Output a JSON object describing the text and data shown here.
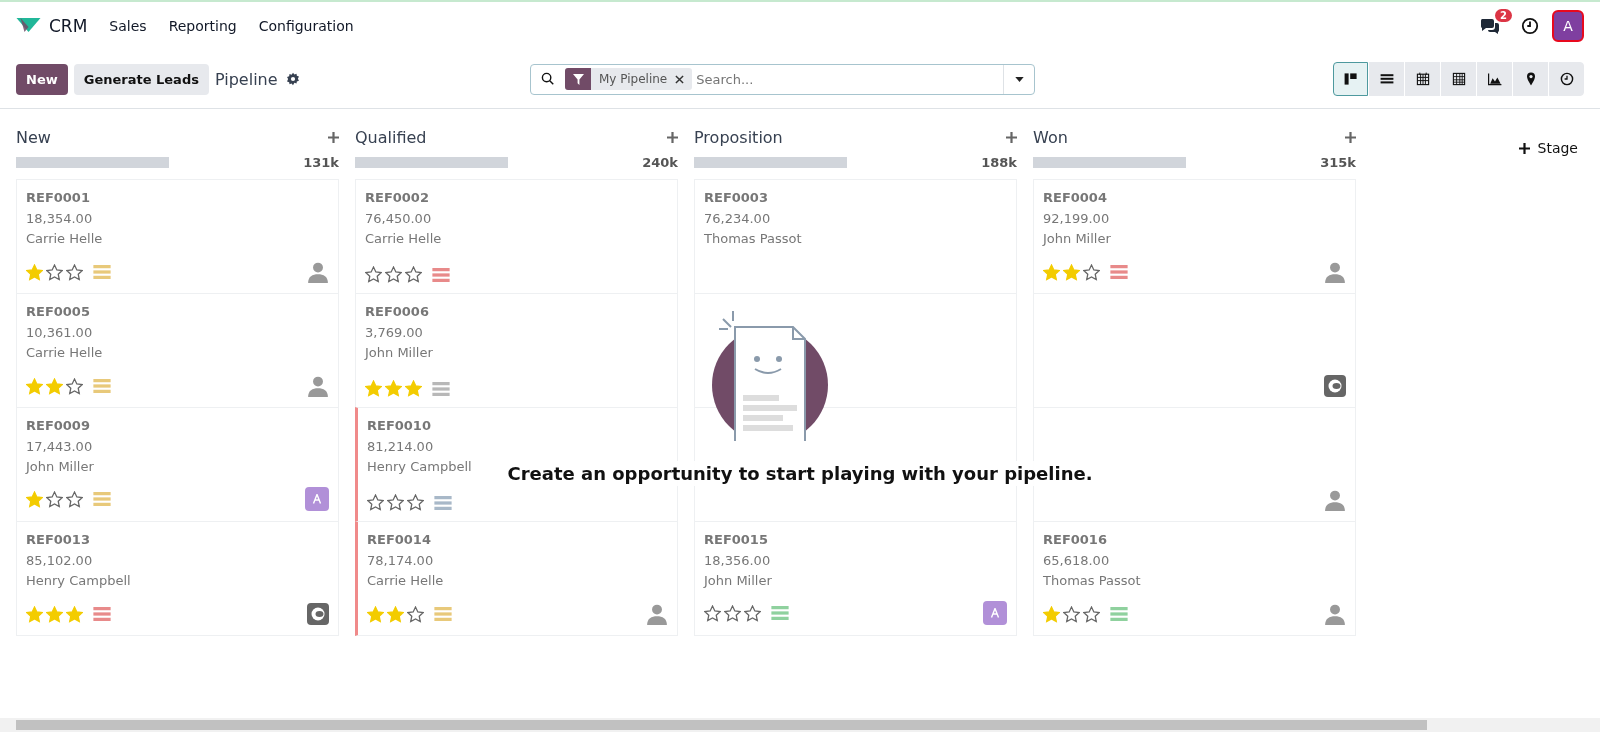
{
  "navbar": {
    "app": "CRM",
    "menus": [
      "Sales",
      "Reporting",
      "Configuration"
    ],
    "messages_badge": "2",
    "avatar": "A"
  },
  "control_panel": {
    "new_button": "New",
    "generate_button": "Generate Leads",
    "breadcrumb": "Pipeline",
    "filter_facet": "My Pipeline",
    "search_placeholder": "Search...",
    "views": [
      {
        "kind": "kanban",
        "selected": true
      },
      {
        "kind": "list",
        "selected": false
      },
      {
        "kind": "calendar",
        "selected": false
      },
      {
        "kind": "pivot",
        "selected": false
      },
      {
        "kind": "graph",
        "selected": false
      },
      {
        "kind": "map",
        "selected": false
      },
      {
        "kind": "activity",
        "selected": false
      }
    ]
  },
  "columns": [
    {
      "title": "New",
      "total": "131k",
      "level": 1,
      "cards": [
        {
          "ref": "REF0001",
          "amount": "18,354.00",
          "customer": "Carrie Helle",
          "stars": 1,
          "color": "#e8c97a",
          "avatar": {
            "kind": "person"
          },
          "overdue": false
        },
        {
          "ref": "REF0005",
          "amount": "10,361.00",
          "customer": "Carrie Helle",
          "stars": 2,
          "color": "#e8c97a",
          "avatar": {
            "kind": "person"
          },
          "overdue": false
        },
        {
          "ref": "REF0009",
          "amount": "17,443.00",
          "customer": "John Miller",
          "stars": 1,
          "color": "#e8c97a",
          "avatar": {
            "kind": "letter"
          },
          "overdue": false
        },
        {
          "ref": "REF0013",
          "amount": "85,102.00",
          "customer": "Henry Campbell",
          "stars": 3,
          "color": "#e88a8a",
          "avatar": {
            "kind": "logo"
          },
          "overdue": false
        }
      ]
    },
    {
      "title": "Qualified",
      "total": "240k",
      "level": 1,
      "cards": [
        {
          "ref": "REF0002",
          "amount": "76,450.00",
          "customer": "Carrie Helle",
          "stars": 0,
          "color": "#e88a8a",
          "overdue": false
        },
        {
          "ref": "REF0006",
          "amount": "3,769.00",
          "customer": "John Miller",
          "stars": 3,
          "color": "#b8b8b8",
          "overdue": false
        },
        {
          "ref": "REF0010",
          "amount": "81,214.00",
          "customer": "Henry Campbell",
          "stars": 0,
          "color": "#a8b8c8",
          "overdue": true
        },
        {
          "ref": "REF0014",
          "amount": "78,174.00",
          "customer": "Carrie Helle",
          "stars": 2,
          "color": "#e8c97a",
          "avatar": {
            "kind": "person"
          },
          "overdue": true
        }
      ]
    },
    {
      "title": "Proposition",
      "total": "188k",
      "level": 1,
      "cards": [
        {
          "ref": "REF0003",
          "amount": "76,234.00",
          "customer": "Thomas Passot",
          "overdue": false
        },
        {
          "overdue": false
        },
        {
          "overdue": false
        },
        {
          "ref": "REF0015",
          "amount": "18,356.00",
          "customer": "John Miller",
          "stars": 0,
          "color": "#8fd19e",
          "avatar": {
            "kind": "letter"
          },
          "overdue": false
        }
      ]
    },
    {
      "title": "Won",
      "total": "315k",
      "level": 1,
      "cards": [
        {
          "ref": "REF0004",
          "amount": "92,199.00",
          "customer": "John Miller",
          "stars": 2,
          "color": "#e88a8a",
          "avatar": {
            "kind": "person"
          },
          "overdue": false
        },
        {
          "avatar": {
            "kind": "logo"
          },
          "overdue": false
        },
        {
          "avatar": {
            "kind": "person"
          },
          "overdue": false
        },
        {
          "ref": "REF0016",
          "amount": "65,618.00",
          "customer": "Thomas Passot",
          "stars": 1,
          "color": "#8fd19e",
          "avatar": {
            "kind": "person"
          },
          "overdue": false
        }
      ]
    }
  ],
  "add_stage": "Stage",
  "empty_state": {
    "message": "Create an opportunity to start playing with your pipeline."
  }
}
